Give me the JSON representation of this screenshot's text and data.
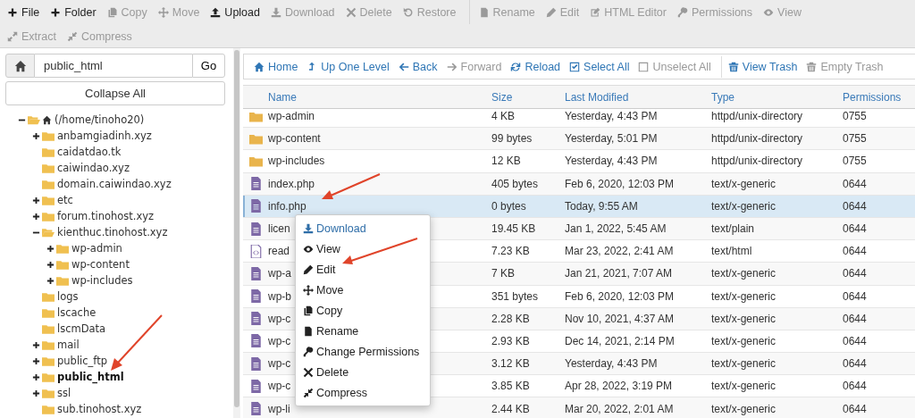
{
  "toolbar": {
    "rows": [
      [
        [
          {
            "label": "File",
            "disabled": false
          },
          {
            "label": "Folder",
            "disabled": false
          },
          {
            "label": "Copy",
            "disabled": true
          },
          {
            "label": "Move",
            "disabled": true
          },
          {
            "label": "Upload",
            "disabled": false
          },
          {
            "label": "Download",
            "disabled": true
          },
          {
            "label": "Delete",
            "disabled": true
          },
          {
            "label": "Restore",
            "disabled": true
          }
        ],
        [
          {
            "label": "Rename",
            "disabled": true
          },
          {
            "label": "Edit",
            "disabled": true
          },
          {
            "label": "HTML Editor",
            "disabled": true
          },
          {
            "label": "Permissions",
            "disabled": true
          },
          {
            "label": "View",
            "disabled": true
          }
        ]
      ],
      [
        [
          {
            "label": "Extract",
            "disabled": true
          },
          {
            "label": "Compress",
            "disabled": true
          }
        ]
      ]
    ]
  },
  "path_bar": {
    "value": "public_html",
    "go": "Go"
  },
  "collapse_all": "Collapse All",
  "tree": [
    {
      "label": "(/home/tinoho20)",
      "expanded": true,
      "selected": false,
      "children": [
        {
          "label": "anbamgiadinh.xyz",
          "expanded": false,
          "selected": false
        },
        {
          "label": "caidatdao.tk",
          "selected": false
        },
        {
          "label": "caiwindao.xyz",
          "selected": false
        },
        {
          "label": "domain.caiwindao.xyz",
          "selected": false
        },
        {
          "label": "etc",
          "expanded": false,
          "selected": false
        },
        {
          "label": "forum.tinohost.xyz",
          "expanded": false,
          "selected": false
        },
        {
          "label": "kienthuc.tinohost.xyz",
          "expanded": true,
          "selected": false,
          "children": [
            {
              "label": "wp-admin",
              "expanded": false,
              "selected": false
            },
            {
              "label": "wp-content",
              "expanded": false,
              "selected": false
            },
            {
              "label": "wp-includes",
              "expanded": false,
              "selected": false
            }
          ]
        },
        {
          "label": "logs",
          "selected": false
        },
        {
          "label": "lscache",
          "selected": false
        },
        {
          "label": "lscmData",
          "selected": false
        },
        {
          "label": "mail",
          "expanded": false,
          "selected": false
        },
        {
          "label": "public_ftp",
          "expanded": false,
          "selected": false
        },
        {
          "label": "public_html",
          "expanded": false,
          "selected": true
        },
        {
          "label": "ssl",
          "expanded": false,
          "selected": false
        },
        {
          "label": "sub.tinohost.xyz",
          "selected": false
        }
      ]
    }
  ],
  "nav": [
    [
      {
        "label": "Home",
        "disabled": false
      },
      {
        "label": "Up One Level",
        "disabled": false
      },
      {
        "label": "Back",
        "disabled": false
      },
      {
        "label": "Forward",
        "disabled": true
      },
      {
        "label": "Reload",
        "disabled": false
      },
      {
        "label": "Select All",
        "disabled": false
      },
      {
        "label": "Unselect All",
        "disabled": true
      }
    ],
    [
      {
        "label": "View Trash",
        "disabled": false
      },
      {
        "label": "Empty Trash",
        "disabled": true
      }
    ]
  ],
  "table": {
    "columns": [
      "Name",
      "Size",
      "Last Modified",
      "Type",
      "Permissions"
    ],
    "rows": [
      {
        "kind": "folder",
        "name": "wp-admin",
        "size": "4 KB",
        "modified": "Yesterday, 4:43 PM",
        "type": "httpd/unix-directory",
        "perms": "0755",
        "selected": false
      },
      {
        "kind": "folder",
        "name": "wp-content",
        "size": "99 bytes",
        "modified": "Yesterday, 5:01 PM",
        "type": "httpd/unix-directory",
        "perms": "0755",
        "selected": false
      },
      {
        "kind": "folder",
        "name": "wp-includes",
        "size": "12 KB",
        "modified": "Yesterday, 4:43 PM",
        "type": "httpd/unix-directory",
        "perms": "0755",
        "selected": false
      },
      {
        "kind": "file",
        "name": "index.php",
        "size": "405 bytes",
        "modified": "Feb 6, 2020, 12:03 PM",
        "type": "text/x-generic",
        "perms": "0644",
        "selected": false
      },
      {
        "kind": "file",
        "name": "info.php",
        "size": "0 bytes",
        "modified": "Today, 9:55 AM",
        "type": "text/x-generic",
        "perms": "0644",
        "selected": true
      },
      {
        "kind": "file",
        "name": "licen",
        "size": "19.45 KB",
        "modified": "Jan 1, 2022, 5:45 AM",
        "type": "text/plain",
        "perms": "0644",
        "selected": false
      },
      {
        "kind": "html",
        "name": "read",
        "size": "7.23 KB",
        "modified": "Mar 23, 2022, 2:41 AM",
        "type": "text/html",
        "perms": "0644",
        "selected": false
      },
      {
        "kind": "file",
        "name": "wp-a",
        "size": "7 KB",
        "modified": "Jan 21, 2021, 7:07 AM",
        "type": "text/x-generic",
        "perms": "0644",
        "selected": false
      },
      {
        "kind": "file",
        "name": "wp-b",
        "size": "351 bytes",
        "modified": "Feb 6, 2020, 12:03 PM",
        "type": "text/x-generic",
        "perms": "0644",
        "selected": false
      },
      {
        "kind": "file",
        "name": "wp-c",
        "size": "2.28 KB",
        "modified": "Nov 10, 2021, 4:37 AM",
        "type": "text/x-generic",
        "perms": "0644",
        "selected": false
      },
      {
        "kind": "file",
        "name": "wp-c",
        "size": "2.93 KB",
        "modified": "Dec 14, 2021, 2:14 PM",
        "type": "text/x-generic",
        "perms": "0644",
        "selected": false
      },
      {
        "kind": "file",
        "name": "wp-c",
        "size": "3.12 KB",
        "modified": "Yesterday, 4:43 PM",
        "type": "text/x-generic",
        "perms": "0644",
        "selected": false
      },
      {
        "kind": "file",
        "name": "wp-c",
        "size": "3.85 KB",
        "modified": "Apr 28, 2022, 3:19 PM",
        "type": "text/x-generic",
        "perms": "0644",
        "selected": false
      },
      {
        "kind": "file",
        "name": "wp-li",
        "size": "2.44 KB",
        "modified": "Mar 20, 2022, 2:01 AM",
        "type": "text/x-generic",
        "perms": "0644",
        "selected": false
      }
    ]
  },
  "context_menu": [
    {
      "label": "Download",
      "selected": true
    },
    {
      "label": "View",
      "selected": false
    },
    {
      "label": "Edit",
      "selected": false
    },
    {
      "label": "Move",
      "selected": false
    },
    {
      "label": "Copy",
      "selected": false
    },
    {
      "label": "Rename",
      "selected": false
    },
    {
      "label": "Change Permissions",
      "selected": false
    },
    {
      "label": "Delete",
      "selected": false
    },
    {
      "label": "Compress",
      "selected": false
    }
  ]
}
